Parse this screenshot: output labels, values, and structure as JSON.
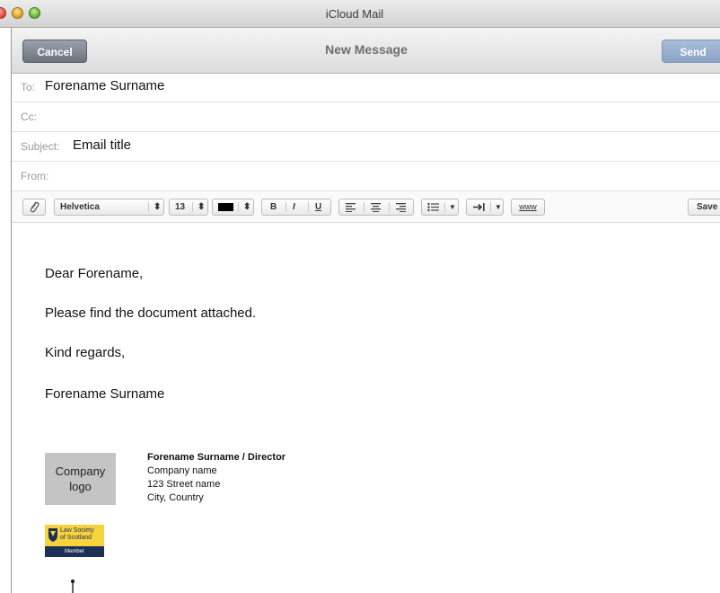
{
  "window": {
    "title": "iCloud Mail"
  },
  "toolbar": {
    "cancel_label": "Cancel",
    "heading": "New Message",
    "send_label": "Send"
  },
  "fields": {
    "to_label": "To:",
    "to_value": "Forename Surname",
    "cc_label": "Cc:",
    "cc_value": "",
    "subject_label": "Subject:",
    "subject_value": "Email title",
    "from_label": "From:",
    "from_value": ""
  },
  "format_bar": {
    "font": "Helvetica",
    "size": "13",
    "text_color": "#000000",
    "bold": "B",
    "italic": "I",
    "underline": "U",
    "link": "www",
    "save_label": "Save",
    "icons": [
      "paperclip-icon",
      "align-left-icon",
      "align-center-icon",
      "align-right-icon",
      "list-icon",
      "indent-icon"
    ]
  },
  "message": {
    "greeting": "Dear Forename,",
    "line1": "Please find the document attached.",
    "closing": "Kind regards,",
    "sender": "Forename Surname"
  },
  "signature": {
    "logo_text": "Company logo",
    "name": "Forename Surname",
    "role": "Director",
    "divider": "/",
    "company": "Company name",
    "street": "123 Street name",
    "city": "City, Country",
    "badge_line1": "Law Society",
    "badge_line2": "of Scotland",
    "badge_member": "Member",
    "badge_colors": {
      "top": "#f6d33c",
      "bottom": "#1d2e57"
    }
  }
}
